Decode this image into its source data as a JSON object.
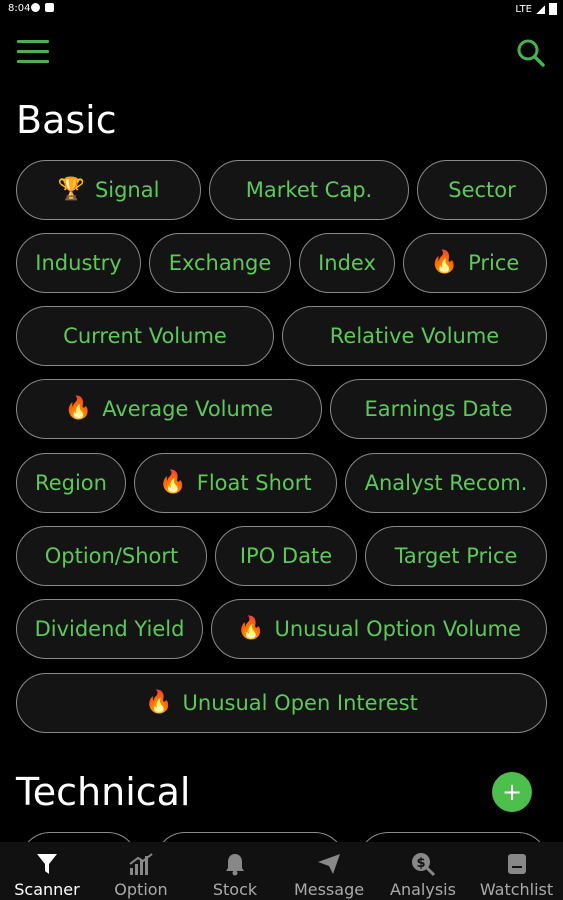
{
  "status_bar": {
    "time": "8:04",
    "network": "LTE"
  },
  "sections": {
    "basic": "Basic",
    "technical": "Technical"
  },
  "chips": [
    {
      "label": "Signal",
      "icon": "trophy-icon"
    },
    {
      "label": "Market Cap.",
      "icon": ""
    },
    {
      "label": "Sector",
      "icon": ""
    },
    {
      "label": "Industry",
      "icon": ""
    },
    {
      "label": "Exchange",
      "icon": ""
    },
    {
      "label": "Index",
      "icon": ""
    },
    {
      "label": "Price",
      "icon": "fire-icon"
    },
    {
      "label": "Current Volume",
      "icon": ""
    },
    {
      "label": "Relative Volume",
      "icon": ""
    },
    {
      "label": "Average Volume",
      "icon": "fire-icon"
    },
    {
      "label": "Earnings Date",
      "icon": ""
    },
    {
      "label": "Region",
      "icon": ""
    },
    {
      "label": "Float Short",
      "icon": "fire-icon"
    },
    {
      "label": "Analyst Recom.",
      "icon": ""
    },
    {
      "label": "Option/Short",
      "icon": ""
    },
    {
      "label": "IPO Date",
      "icon": ""
    },
    {
      "label": "Target Price",
      "icon": ""
    },
    {
      "label": "Dividend Yield",
      "icon": ""
    },
    {
      "label": "Unusual Option Volume",
      "icon": "fire-icon"
    },
    {
      "label": "Unusual Open Interest",
      "icon": "fire-icon"
    }
  ],
  "fab": {
    "label": "+"
  },
  "bottom_nav": [
    {
      "label": "Scanner",
      "icon": "filter-icon",
      "active": true
    },
    {
      "label": "Option",
      "icon": "bar-chart-icon",
      "active": false
    },
    {
      "label": "Stock",
      "icon": "bell-icon",
      "active": false
    },
    {
      "label": "Message",
      "icon": "send-icon",
      "active": false
    },
    {
      "label": "Analysis",
      "icon": "dollar-search-icon",
      "active": false
    },
    {
      "label": "Watchlist",
      "icon": "list-icon",
      "active": false
    }
  ],
  "colors": {
    "accent": "#5ec85a",
    "background": "#000000",
    "chip_border": "#8a8a8a",
    "fab": "#4cbf4c"
  }
}
